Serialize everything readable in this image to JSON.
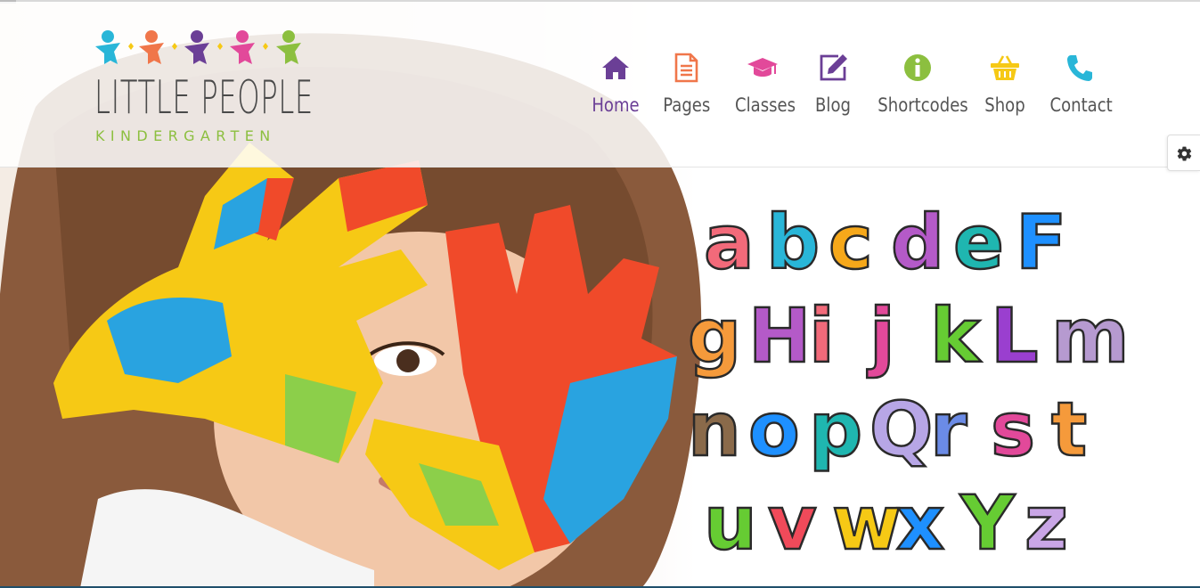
{
  "site": {
    "logo": {
      "title": "LITTLE PEOPLE",
      "subtitle": "KINDERGARTEN"
    },
    "nav": [
      {
        "label": "Home",
        "icon": "home-icon",
        "color": "#6b3f96",
        "active": true
      },
      {
        "label": "Pages",
        "icon": "page-icon",
        "color": "#f0764a",
        "active": false
      },
      {
        "label": "Classes",
        "icon": "graduation-cap-icon",
        "color": "#e2499a",
        "active": false
      },
      {
        "label": "Blog",
        "icon": "edit-icon",
        "color": "#6b3f96",
        "active": false
      },
      {
        "label": "Shortcodes",
        "icon": "info-icon",
        "color": "#8cbf3f",
        "active": false
      },
      {
        "label": "Shop",
        "icon": "basket-icon",
        "color": "#f6c915",
        "active": false
      },
      {
        "label": "Contact",
        "icon": "phone-icon",
        "color": "#29b6d8",
        "active": false
      }
    ],
    "settings_icon": "gear-icon",
    "colors": {
      "purple": "#6b3f96",
      "orange": "#f0764a",
      "pink": "#e2499a",
      "green": "#8cbf3f",
      "yellow": "#f6c915",
      "teal": "#29b6d8"
    }
  },
  "hero": {
    "alphabet_rows": [
      {
        "letters": [
          "a",
          "b",
          "c",
          "d",
          "e",
          "F"
        ],
        "colors": [
          "#f26a7a",
          "#29b6d8",
          "#f6a81a",
          "#b45ac8",
          "#1fb6b0",
          "#1e90ff"
        ]
      },
      {
        "letters": [
          "g",
          "H",
          "i",
          "j",
          "k",
          "L",
          "m"
        ],
        "colors": [
          "#f59a3b",
          "#b45ac8",
          "#f26a7a",
          "#e2499a",
          "#66cc33",
          "#9a3fcf",
          "#b69ad0"
        ]
      },
      {
        "letters": [
          "n",
          "o",
          "p",
          "Q",
          "r",
          "s",
          "t"
        ],
        "colors": [
          "#8a6a4a",
          "#1e90ff",
          "#1fb6b0",
          "#b7a6e6",
          "#6b8be6",
          "#e2499a",
          "#f59a3b"
        ]
      },
      {
        "letters": [
          "u",
          "v",
          "w",
          "x",
          "Y",
          "z"
        ],
        "colors": [
          "#66cc33",
          "#f04a5a",
          "#f6c915",
          "#1e90ff",
          "#66cc33",
          "#c9a6e6"
        ]
      }
    ]
  }
}
